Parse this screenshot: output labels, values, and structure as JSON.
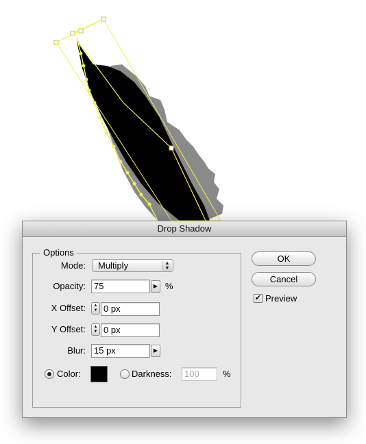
{
  "dialog": {
    "title": "Drop Shadow",
    "options_title": "Options",
    "mode": {
      "label": "Mode:",
      "value": "Multiply"
    },
    "opacity": {
      "label": "Opacity:",
      "value": "75",
      "unit": "%"
    },
    "x_offset": {
      "label": "X Offset:",
      "value": "0 px"
    },
    "y_offset": {
      "label": "Y Offset:",
      "value": "0 px"
    },
    "blur": {
      "label": "Blur:",
      "value": "15 px"
    },
    "color": {
      "label": "Color:",
      "selected": true,
      "swatch": "#000000"
    },
    "darkness": {
      "label": "Darkness:",
      "value": "100",
      "unit": "%",
      "selected": false
    },
    "buttons": {
      "ok": "OK",
      "cancel": "Cancel"
    },
    "preview": {
      "label": "Preview",
      "checked": true
    }
  },
  "artwork": {
    "shape_color": "#000000",
    "shadow_color": "#8a8a8a",
    "selection_color": "#f0f050"
  }
}
